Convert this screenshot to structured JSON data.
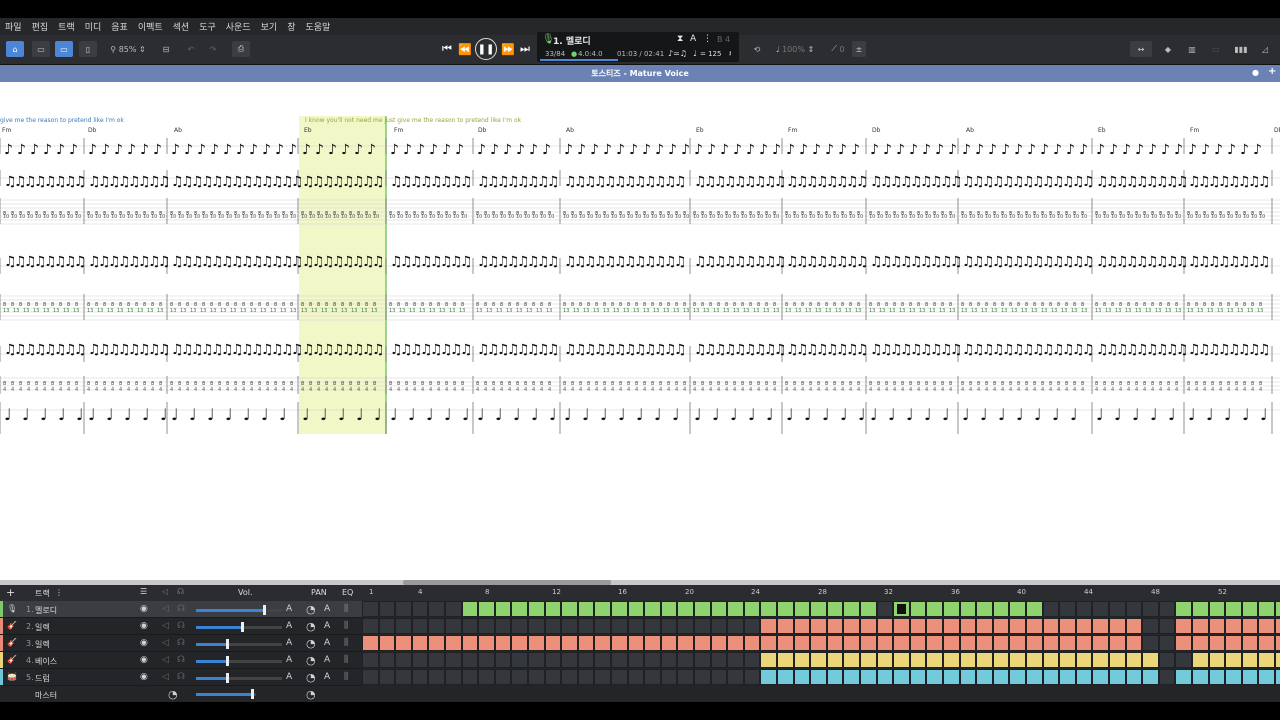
{
  "menu": [
    "파일",
    "편집",
    "트랙",
    "미디",
    "음표",
    "이펙트",
    "섹션",
    "도구",
    "사운드",
    "보기",
    "창",
    "도움말"
  ],
  "toolbar": {
    "zoom": "85%"
  },
  "display": {
    "track_name": "1. 멜로디",
    "position": "33/84",
    "beat": "4.0:4.0",
    "time": "01:03 / 02:41",
    "tempo": "= 125",
    "key": "B 4",
    "speed": "100%",
    "pitch": "0"
  },
  "score_title": "토스티즈 - Mature Voice",
  "lyrics": [
    "give me the reason to pretend like  I'm ok",
    "I  know you'll not need me just give me the reason to pretend like  I'm ok"
  ],
  "chords": [
    "Fm",
    "Db",
    "Ab",
    "Eb",
    "Fm",
    "Db",
    "Ab",
    "Eb",
    "Fm",
    "Db",
    "Ab",
    "Eb",
    "Fm",
    "Db"
  ],
  "track_header": {
    "track_label": "트랙",
    "vol_label": "Vol.",
    "pan_label": "PAN",
    "eq_label": "EQ"
  },
  "tracks": [
    {
      "num": "1.",
      "name": "멜로디",
      "color": "#7fc96b",
      "vol": 0.78
    },
    {
      "num": "2.",
      "name": "일렉",
      "color": "#e88a78",
      "vol": 0.52
    },
    {
      "num": "3.",
      "name": "일렉",
      "color": "#e88a78",
      "vol": 0.35
    },
    {
      "num": "4.",
      "name": "베이스",
      "color": "#e8d27a",
      "vol": 0.35
    },
    {
      "num": "5.",
      "name": "드럼",
      "color": "#6fc6d6",
      "vol": 0.35
    }
  ],
  "master_label": "마스터",
  "measure_numbers": [
    "1",
    "4",
    "8",
    "12",
    "16",
    "20",
    "24",
    "28",
    "32",
    "36",
    "40",
    "44",
    "48",
    "52"
  ],
  "grid_rows": [
    "......GGGGGGGGGGGGGGGGGGGGGGGGG.GGGGGGGGG........GGGGGGGGGGG",
    "........................RRRRRRRRRRRRRRRRRRRRRRR..RRRRRRR..RR",
    "RRRRRRRRRRRRRRRRRRRRRRRRRRRRRRRRRRRRRRRRRRRRRRR..RRRRRRRRRRR",
    "........................YYYYYYYYYYYYYYYYYYYYYYYY..YYYYYYYYYYY",
    "........................CCCCCCCCCCCCCCCCCCCCCCCC.CCCCCCCCCCCC"
  ]
}
